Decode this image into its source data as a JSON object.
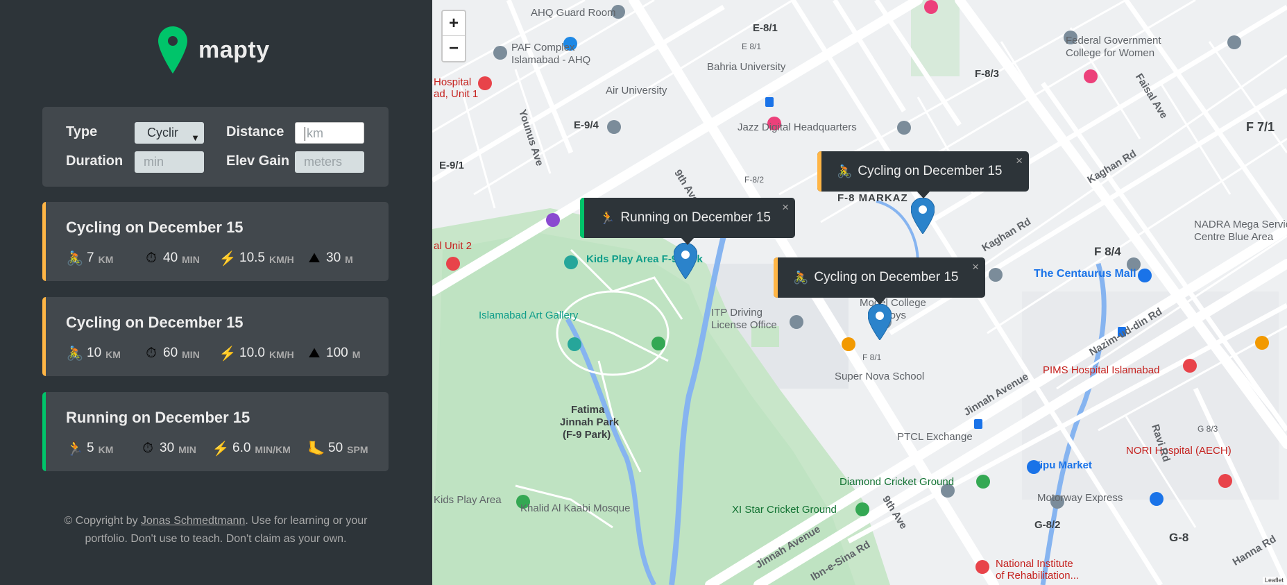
{
  "brand": {
    "name": "mapty",
    "accent": "#00c46a"
  },
  "form": {
    "type_label": "Type",
    "type_value": "Cyclir",
    "distance_label": "Distance",
    "distance_placeholder": "km",
    "duration_label": "Duration",
    "duration_placeholder": "min",
    "elev_label": "Elev Gain",
    "elev_placeholder": "meters"
  },
  "workouts": [
    {
      "title": "Cycling on December 15",
      "color": "#ffb545",
      "stats": [
        {
          "icon": "🚴",
          "value": "7",
          "unit": "KM"
        },
        {
          "icon": "⏱",
          "value": "40",
          "unit": "MIN"
        },
        {
          "icon": "⚡️",
          "value": "10.5",
          "unit": "KM/H"
        },
        {
          "icon": "⛰",
          "value": "30",
          "unit": "M"
        }
      ]
    },
    {
      "title": "Cycling on December 15",
      "color": "#ffb545",
      "stats": [
        {
          "icon": "🚴",
          "value": "10",
          "unit": "KM"
        },
        {
          "icon": "⏱",
          "value": "60",
          "unit": "MIN"
        },
        {
          "icon": "⚡️",
          "value": "10.0",
          "unit": "KM/H"
        },
        {
          "icon": "⛰",
          "value": "100",
          "unit": "M"
        }
      ]
    },
    {
      "title": "Running on December 15",
      "color": "#00c46a",
      "stats": [
        {
          "icon": "🏃",
          "value": "5",
          "unit": "KM"
        },
        {
          "icon": "⏱",
          "value": "30",
          "unit": "MIN"
        },
        {
          "icon": "⚡️",
          "value": "6.0",
          "unit": "MIN/KM"
        },
        {
          "icon": "🦶",
          "value": "50",
          "unit": "SPM"
        }
      ]
    }
  ],
  "copyright": {
    "prefix": "© Copyright by ",
    "author": "Jonas Schmedtmann",
    "suffix": ". Use for learning or your portfolio. Don't use to teach. Don't claim as your own."
  },
  "map": {
    "zoom_in": "+",
    "zoom_out": "−",
    "attribution": "Leaflet",
    "popups": [
      {
        "icon": "🏃",
        "text": "Running on December 15",
        "color": "#00c46a",
        "close": "×"
      },
      {
        "icon": "🚴",
        "text": "Cycling on December 15",
        "color": "#ffb545",
        "close": "×"
      },
      {
        "icon": "🚴",
        "text": "Cycling on December 15",
        "color": "#ffb545",
        "close": "×"
      }
    ],
    "labels": {
      "ahq": "AHQ Guard Room",
      "e81": "E-8/1",
      "e81b": "E 8/1",
      "paf1": "PAF Complex",
      "paf2": "Islamabad - AHQ",
      "bahria": "Bahria University",
      "air": "Air University",
      "fedgov1": "Federal Government",
      "fedgov2": "College for Women",
      "f83": "F-8/3",
      "e94": "E-9/4",
      "jazz": "Jazz Digital Headquarters",
      "e91": "E-9/1",
      "f82": "F-8/2",
      "f71": "F 7/1",
      "markaz": "F-8 MARKAZ",
      "kids": "Kids Play Area F-9 Park",
      "nadra1": "NADRA Mega Service",
      "nadra2": "Centre Blue Area",
      "f84": "F 8/4",
      "centaurus": "The Centaurus Mall",
      "artgal": "Islamabad Art Gallery",
      "itp1": "ITP Driving",
      "itp2": "License Office",
      "model1": "Model College",
      "model2": "for Boys",
      "f81": "F 8/1",
      "supernova": "Super Nova School",
      "pims": "PIMS Hospital Islamabad",
      "fatima1": "Fatima",
      "fatima2": "Jinnah Park",
      "fatima3": "(F-9 Park)",
      "ptcl": "PTCL Exchange",
      "g83": "G 8/3",
      "nori": "NORI Hospital (AECH)",
      "tipu": "Tipu Market",
      "diamond": "Diamond Cricket Ground",
      "kids2": "Kids Play Area",
      "khalid": "Khalid Al Kaabi Mosque",
      "xistar": "XI Star Cricket Ground",
      "motorway": "Motorway Express",
      "g82": "G-8/2",
      "g8": "G-8",
      "nih1": "National Institute",
      "nih2": "of Rehabilitation...",
      "hospital1": "Hospital",
      "hospital2": "ad, Unit 1",
      "unit2": "al Unit 2",
      "nazim": "Nazim-ud-din Rd",
      "jinnah": "Jinnah Avenue",
      "jinnah2": "Jinnah Avenue",
      "ninth": "9th Ave",
      "ninth2": "9th Ave",
      "kaghan": "Kaghan Rd",
      "kaghan2": "Kaghan Rd",
      "faisal": "Faisal Ave",
      "ravi": "Ravi Rd",
      "hanna": "Hanna Rd",
      "ibnsina": "Ibn-e-Sina Rd",
      "younus": "Younus Ave"
    }
  }
}
